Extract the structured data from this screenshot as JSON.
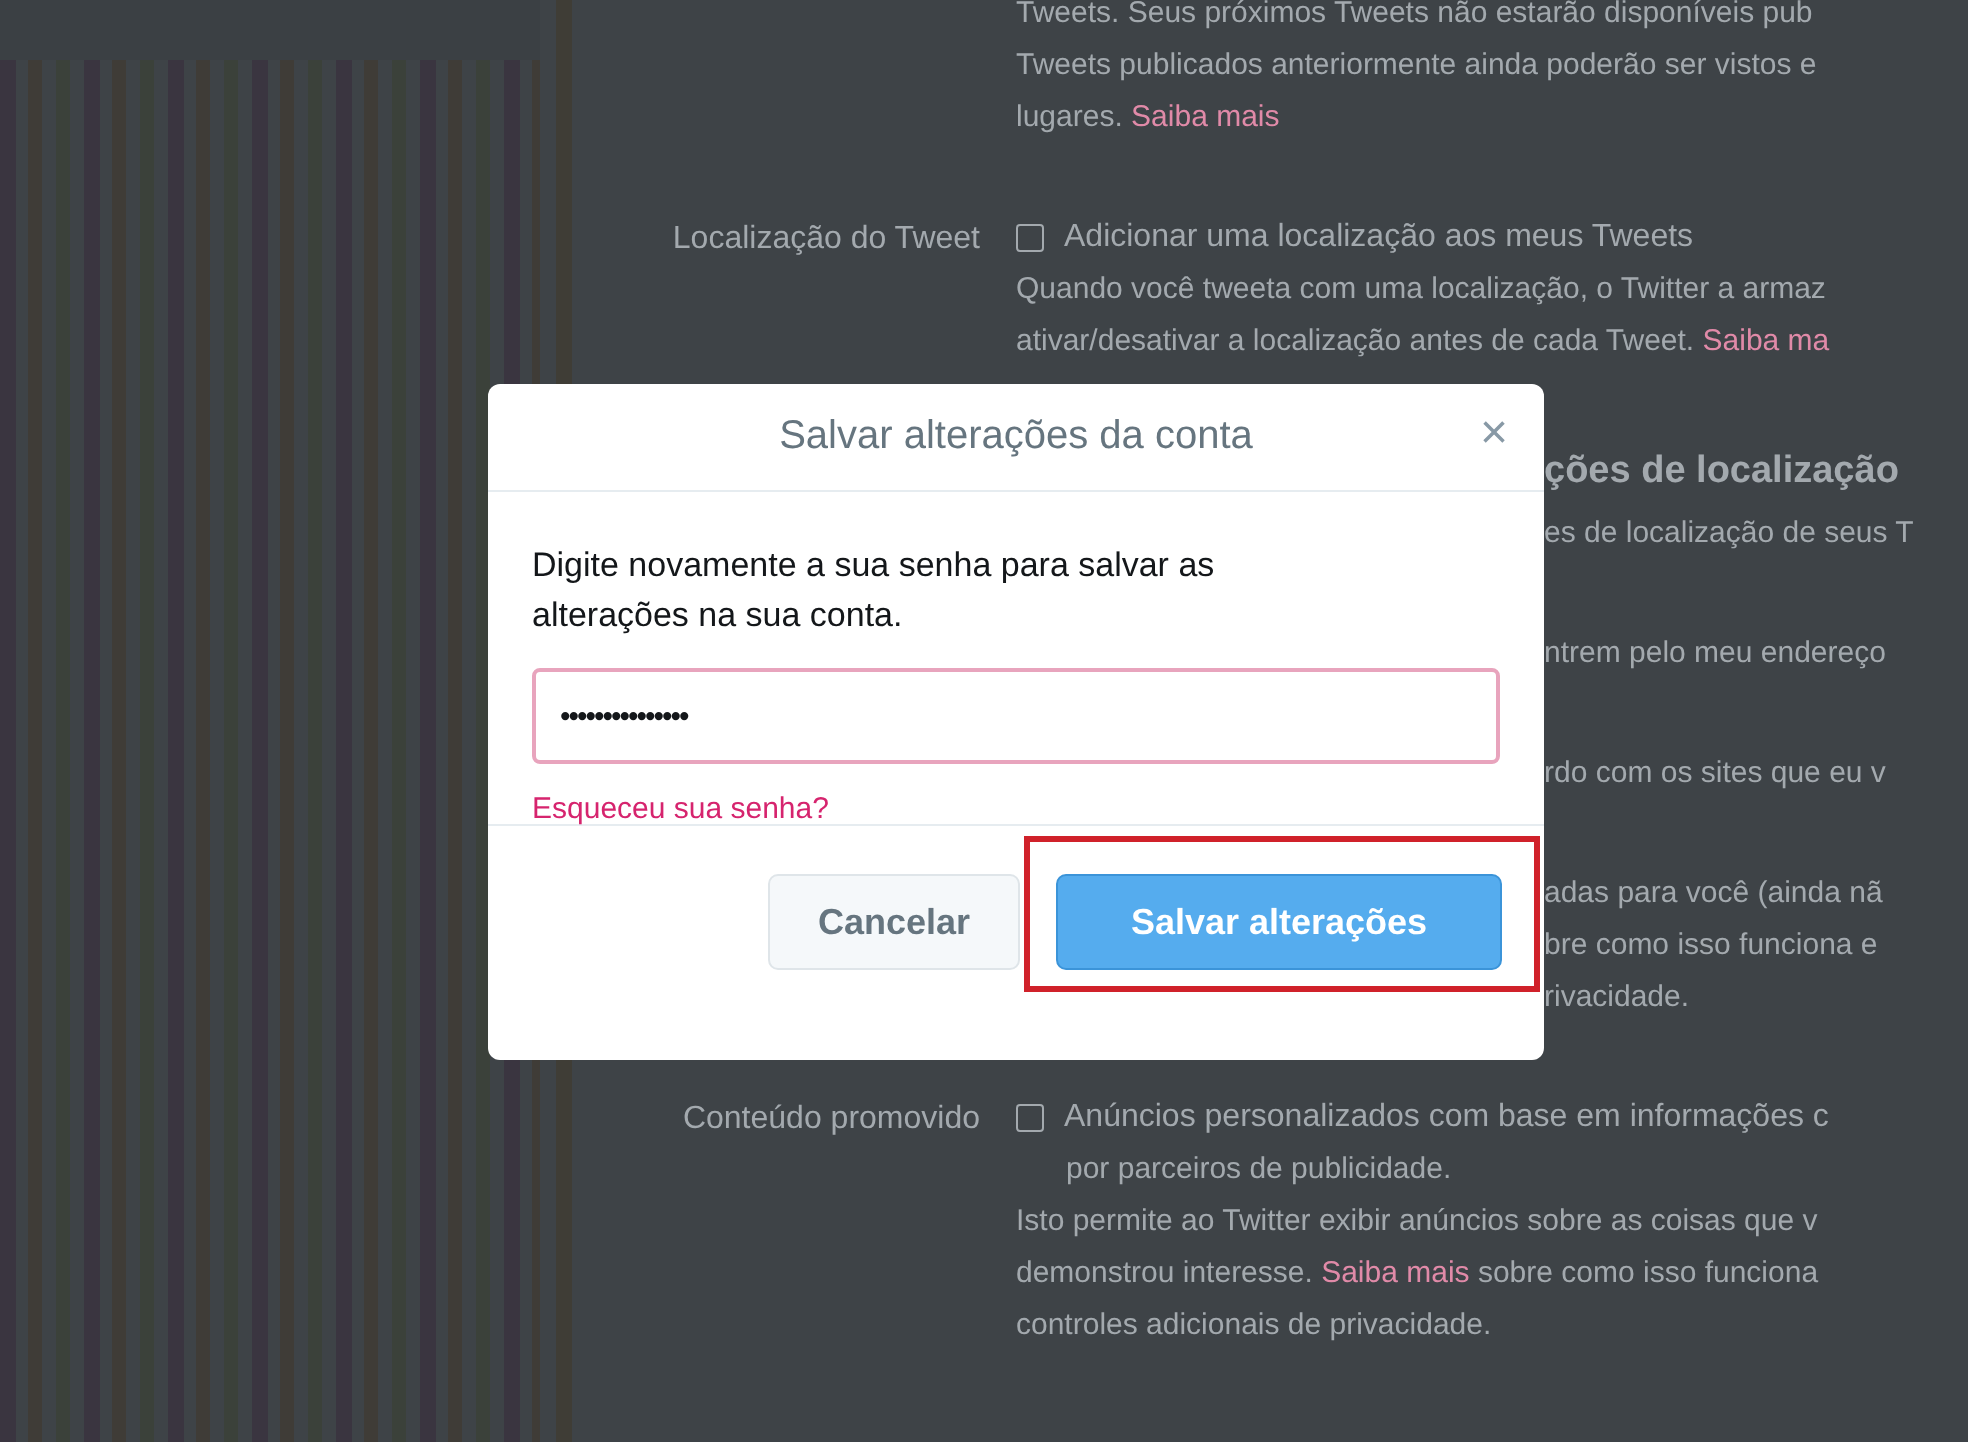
{
  "settings_page": {
    "sections": [
      {
        "lines": [
          {
            "kind": "text",
            "text": "Tweets. Seus próximos Tweets não estarão disponíveis pub"
          },
          {
            "kind": "text",
            "text": "Tweets publicados anteriormente ainda poderão ser vistos e"
          },
          {
            "kind": "text",
            "text": "lugares. ",
            "link": "Saiba mais"
          }
        ]
      },
      {
        "label": "Localização do Tweet",
        "lines": [
          {
            "kind": "checkbox",
            "text": "Adicionar uma localização aos meus Tweets",
            "checked": false
          },
          {
            "kind": "text",
            "text": "Quando você tweeta com uma localização, o Twitter a armaz"
          },
          {
            "kind": "text",
            "text": "ativar/desativar a localização antes de cada Tweet. ",
            "link": "Saiba ma"
          }
        ]
      },
      {
        "lines": [
          {
            "kind": "heading_fragment",
            "text": "ções de localização"
          },
          {
            "kind": "fragment",
            "text": "es de localização de seus T"
          }
        ]
      },
      {
        "lines": [
          {
            "kind": "fragment",
            "text": "ntrem pelo meu endereço"
          }
        ]
      },
      {
        "lines": [
          {
            "kind": "fragment",
            "text": "rdo com os sites que eu v"
          }
        ]
      },
      {
        "lines": [
          {
            "kind": "fragment",
            "text": "adas para você (ainda nã"
          },
          {
            "kind": "fragment",
            "text": "bre como isso funciona e"
          },
          {
            "kind": "fragment",
            "text": "rivacidade."
          }
        ]
      },
      {
        "label": "Conteúdo promovido",
        "lines": [
          {
            "kind": "checkbox",
            "text": "Anúncios personalizados com base em informações c",
            "checked": false
          },
          {
            "kind": "continuation",
            "text": "por parceiros de publicidade."
          },
          {
            "kind": "text",
            "text": "Isto permite ao Twitter exibir anúncios sobre as coisas que v"
          },
          {
            "kind": "text",
            "text": "demonstrou interesse. ",
            "link": "Saiba mais",
            "after": " sobre como isso funciona"
          },
          {
            "kind": "text",
            "text": "controles adicionais de privacidade."
          }
        ]
      }
    ]
  },
  "dialog": {
    "title": "Salvar alterações da conta",
    "close": "×",
    "message": "Digite novamente a sua senha para salvar as alterações na sua conta.",
    "password": {
      "value": "•••••••••••••••"
    },
    "forgot_link": "Esqueceu sua senha?",
    "buttons": [
      {
        "kind": "secondary",
        "label": "Cancelar"
      },
      {
        "kind": "primary",
        "label": "Salvar alterações",
        "highlighted": true
      }
    ]
  }
}
